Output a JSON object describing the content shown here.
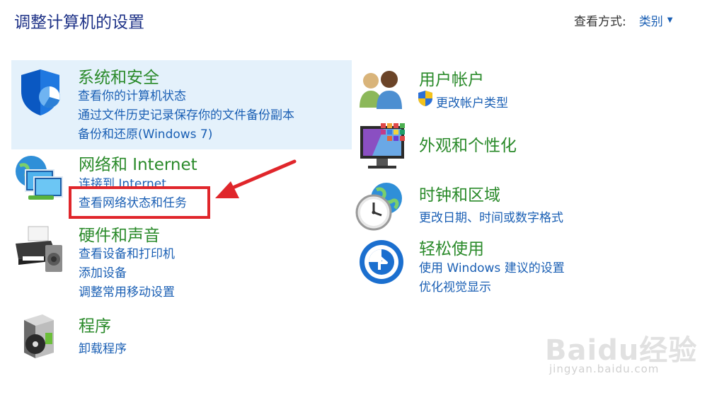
{
  "header": {
    "title": "调整计算机的设置",
    "view_by_label": "查看方式:",
    "view_by_value": "类别"
  },
  "categories": {
    "system": {
      "title": "系统和安全",
      "links": [
        "查看你的计算机状态",
        "通过文件历史记录保存你的文件备份副本",
        "备份和还原(Windows 7)"
      ]
    },
    "network": {
      "title": "网络和 Internet",
      "links": [
        "连接到 Internet",
        "查看网络状态和任务"
      ]
    },
    "hardware": {
      "title": "硬件和声音",
      "links": [
        "查看设备和打印机",
        "添加设备",
        "调整常用移动设置"
      ]
    },
    "programs": {
      "title": "程序",
      "links": [
        "卸载程序"
      ]
    },
    "accounts": {
      "title": "用户帐户",
      "links": [
        "更改帐户类型"
      ]
    },
    "appearance": {
      "title": "外观和个性化",
      "links": []
    },
    "clock": {
      "title": "时钟和区域",
      "links": [
        "更改日期、时间或数字格式"
      ]
    },
    "ease": {
      "title": "轻松使用",
      "links": [
        "使用 Windows 建议的设置",
        "优化视觉显示"
      ]
    }
  },
  "watermark": {
    "logo": "Baidu经验",
    "url": "jingyan.baidu.com"
  },
  "colors": {
    "title_blue": "#1e3287",
    "link_blue": "#1a5fb4",
    "category_green": "#2a8a2a",
    "highlight": "#e4f1fb",
    "annotation_red": "#e0262b"
  }
}
